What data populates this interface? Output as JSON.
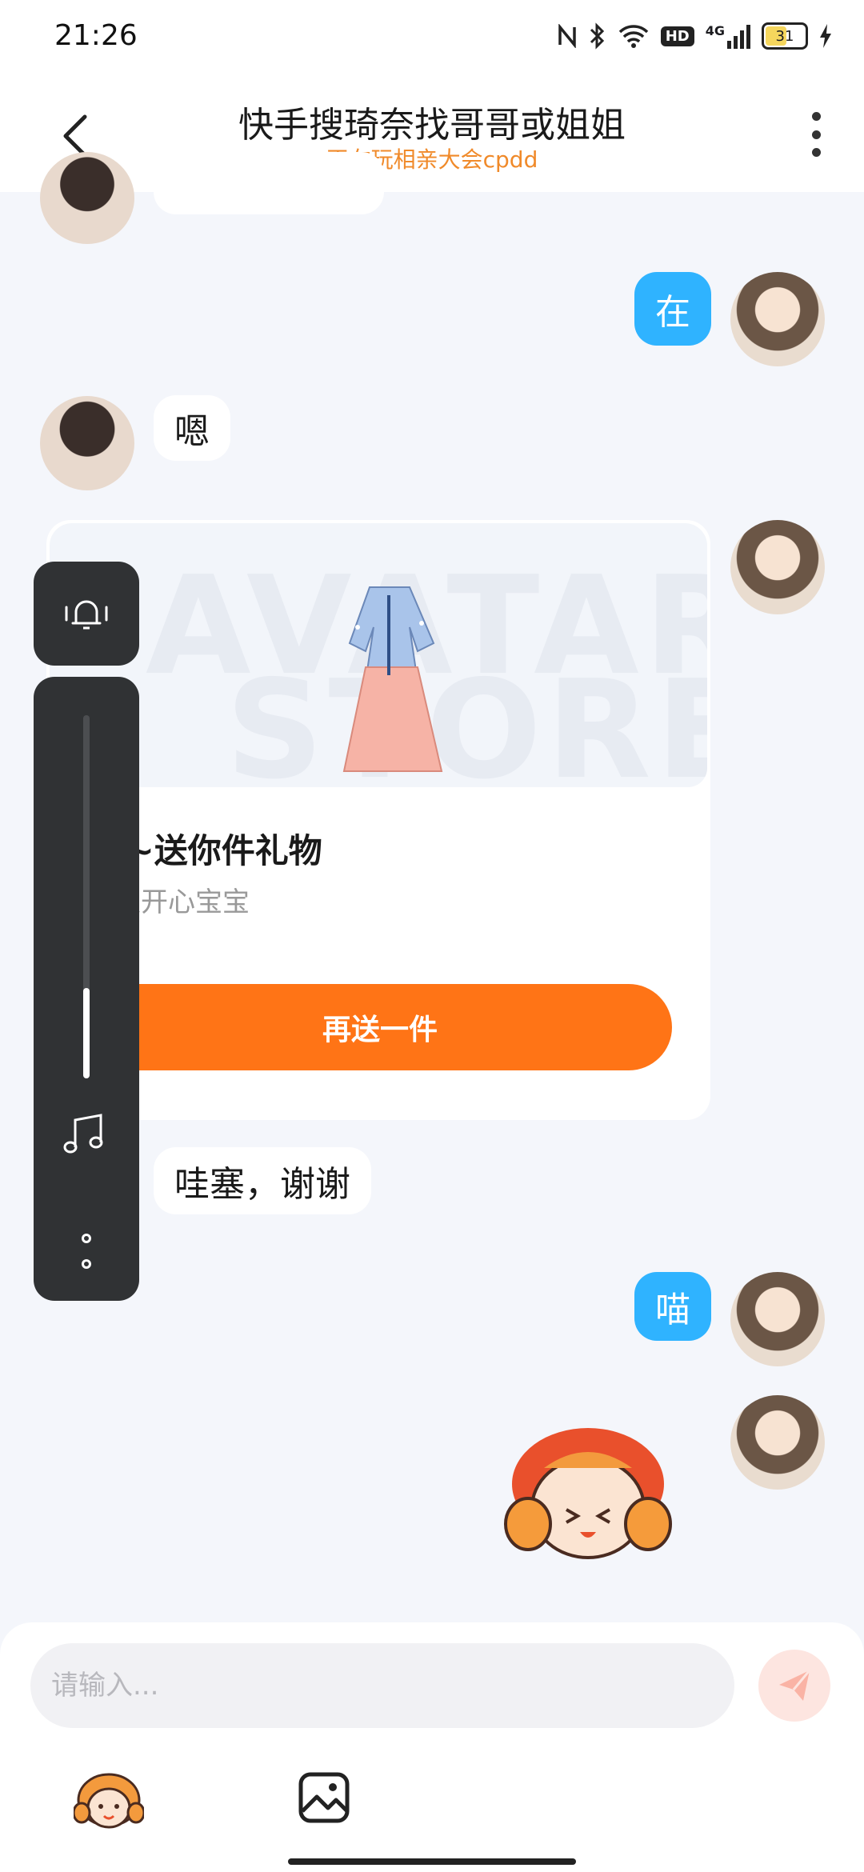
{
  "status_bar": {
    "time": "21:26",
    "battery": "31",
    "network": "4G",
    "hd": "HD"
  },
  "header": {
    "title": "快手搜琦奈找哥哥或姐姐",
    "subtitle": "正在玩相亲大会cpdd"
  },
  "messages": [
    {
      "side": "right",
      "text": "在"
    },
    {
      "side": "left",
      "text": "嗯"
    },
    {
      "side": "left",
      "text": "哇塞，谢谢"
    },
    {
      "side": "right",
      "text": "喵"
    }
  ],
  "gift_card": {
    "watermark_top": "AVATAR",
    "watermark_bottom": "STORE",
    "title": "Hi~送你件礼物",
    "subtitle": "天天开心宝宝",
    "button_label": "再送一件"
  },
  "volume_overlay": {
    "level": 0.25
  },
  "input": {
    "placeholder": "请输入..."
  },
  "icons": [
    "back-arrow-icon",
    "more-vert-icon",
    "bell-icon",
    "music-note-icon",
    "send-icon",
    "emoji-icon",
    "image-icon"
  ],
  "colors": {
    "accent_blue": "#2fb3ff",
    "orange": "#ff7416",
    "subtitle_orange": "#f08a2a"
  }
}
